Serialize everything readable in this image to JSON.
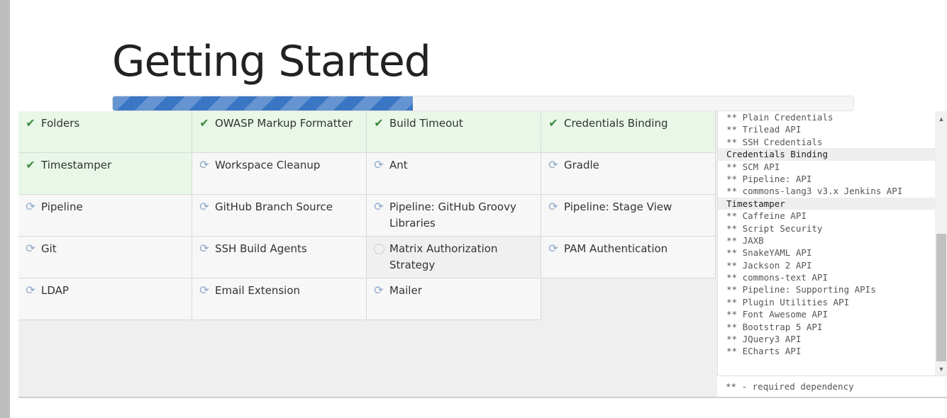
{
  "title": "Getting Started",
  "progress": 0.405,
  "plugins": [
    {
      "label": "Folders",
      "status": "done"
    },
    {
      "label": "OWASP Markup Formatter",
      "status": "done"
    },
    {
      "label": "Build Timeout",
      "status": "done"
    },
    {
      "label": "Credentials Binding",
      "status": "done"
    },
    {
      "label": "Timestamper",
      "status": "done"
    },
    {
      "label": "Workspace Cleanup",
      "status": "installing"
    },
    {
      "label": "Ant",
      "status": "installing"
    },
    {
      "label": "Gradle",
      "status": "installing"
    },
    {
      "label": "Pipeline",
      "status": "installing"
    },
    {
      "label": "GitHub Branch Source",
      "status": "installing"
    },
    {
      "label": "Pipeline: GitHub Groovy Libraries",
      "status": "installing"
    },
    {
      "label": "Pipeline: Stage View",
      "status": "installing"
    },
    {
      "label": "Git",
      "status": "installing"
    },
    {
      "label": "SSH Build Agents",
      "status": "installing"
    },
    {
      "label": "Matrix Authorization Strategy",
      "status": "pending"
    },
    {
      "label": "PAM Authentication",
      "status": "installing"
    },
    {
      "label": "LDAP",
      "status": "installing"
    },
    {
      "label": "Email Extension",
      "status": "installing"
    },
    {
      "label": "Mailer",
      "status": "installing"
    }
  ],
  "dependency_log": [
    {
      "text": "** Plain Credentials",
      "type": "dep"
    },
    {
      "text": "** Trilead API",
      "type": "dep"
    },
    {
      "text": "** SSH Credentials",
      "type": "dep"
    },
    {
      "text": "Credentials Binding",
      "type": "head"
    },
    {
      "text": "** SCM API",
      "type": "dep"
    },
    {
      "text": "** Pipeline: API",
      "type": "dep"
    },
    {
      "text": "** commons-lang3 v3.x Jenkins API",
      "type": "dep"
    },
    {
      "text": "Timestamper",
      "type": "head"
    },
    {
      "text": "** Caffeine API",
      "type": "dep"
    },
    {
      "text": "** Script Security",
      "type": "dep"
    },
    {
      "text": "** JAXB",
      "type": "dep"
    },
    {
      "text": "** SnakeYAML API",
      "type": "dep"
    },
    {
      "text": "** Jackson 2 API",
      "type": "dep"
    },
    {
      "text": "** commons-text API",
      "type": "dep"
    },
    {
      "text": "** Pipeline: Supporting APIs",
      "type": "dep"
    },
    {
      "text": "** Plugin Utilities API",
      "type": "dep"
    },
    {
      "text": "** Font Awesome API",
      "type": "dep"
    },
    {
      "text": "** Bootstrap 5 API",
      "type": "dep"
    },
    {
      "text": "** JQuery3 API",
      "type": "dep"
    },
    {
      "text": "** ECharts API",
      "type": "dep"
    }
  ],
  "footnote": "** - required dependency",
  "colors": {
    "progress": "#3a76c4",
    "done_bg": "#e8f7e8",
    "check": "#3c8a3c"
  }
}
